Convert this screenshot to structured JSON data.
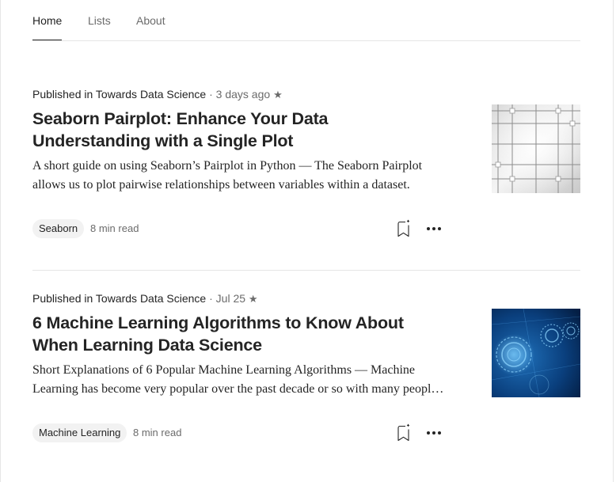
{
  "tabs": [
    {
      "label": "Home",
      "active": true
    },
    {
      "label": "Lists",
      "active": false
    },
    {
      "label": "About",
      "active": false
    }
  ],
  "articles": [
    {
      "published_label": "Published in",
      "publication": "Towards Data Science",
      "separator": "·",
      "date": "3 days ago",
      "star": "★",
      "title": "Seaborn Pairplot: Enhance Your Data Understanding with a Single Plot",
      "snippet": "A short guide on using Seaborn’s Pairplot in Python — The Seaborn Pairplot allows us to plot pairwise relationships between variables within a dataset.",
      "tag": "Seaborn",
      "read_time": "8 min read",
      "thumbnail": "grid-tiles-image"
    },
    {
      "published_label": "Published in",
      "publication": "Towards Data Science",
      "separator": "·",
      "date": "Jul 25",
      "star": "★",
      "title": "6 Machine Learning Algorithms to Know About When Learning Data Science",
      "snippet": "Short Explanations of 6 Popular Machine Learning Algorithms — Machine Learning has become very popular over the past decade or so with many people wanting to learn it.",
      "tag": "Machine Learning",
      "read_time": "8 min read",
      "thumbnail": "blue-circles-image"
    }
  ],
  "colors": {
    "text_primary": "#242424",
    "text_secondary": "#6b6b6b",
    "tag_background": "#f2f2f2",
    "divider": "#e6e6e6"
  }
}
